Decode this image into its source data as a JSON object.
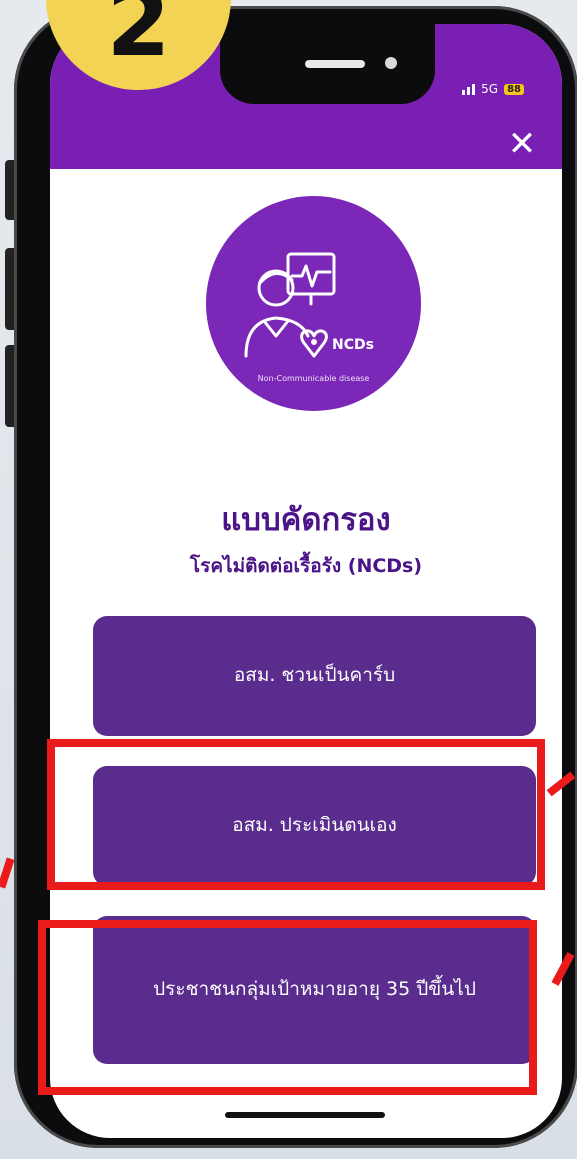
{
  "step_badge": "2",
  "status_bar": {
    "network": "5G",
    "battery": "88"
  },
  "close_label": "✕",
  "logo": {
    "badge_text": "NCDs",
    "subtitle": "Non-Communicable disease"
  },
  "title": "แบบคัดกรอง",
  "subtitle": "โรคไม่ติดต่อเรื้อรัง (NCDs)",
  "buttons": [
    {
      "label": "อสม. ชวนเป็นคาร์บ"
    },
    {
      "label": "อสม. ประเมินตนเอง"
    },
    {
      "label": "ประชาชนกลุ่มเป้าหมายอายุ 35 ปีขึ้นไป"
    }
  ],
  "colors": {
    "primary": "#7a1fb4",
    "button": "#5a2c8e",
    "highlight": "#ea1b1b",
    "badge": "#f3d354"
  }
}
